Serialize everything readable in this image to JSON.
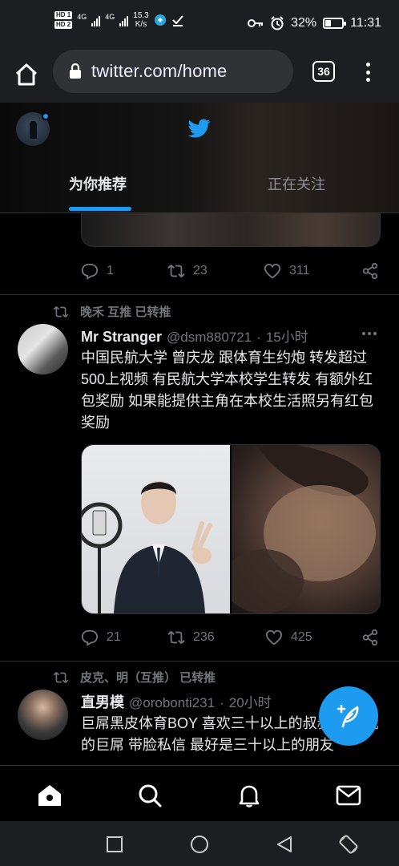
{
  "status_bar": {
    "hd1": "HD 1",
    "hd2": "HD 2",
    "net1": "4G",
    "net2": "4G",
    "speed_value": "15.3",
    "speed_unit": "K/s",
    "battery_text": "32%",
    "battery_level": 0.32,
    "time": "11:31"
  },
  "browser": {
    "url": "twitter.com/home",
    "tab_count": "36"
  },
  "header": {
    "tabs": [
      {
        "label": "为你推荐",
        "active": true
      },
      {
        "label": "正在关注",
        "active": false
      }
    ]
  },
  "tweets": [
    {
      "replies": "1",
      "retweets": "23",
      "likes": "311"
    },
    {
      "retweeted_by": "晚禾 互推 已转推",
      "name": "Mr Stranger",
      "handle": "@dsm880721",
      "time": "15小时",
      "text": "中国民航大学 曾庆龙 跟体育生约炮 转发超过500上视频 有民航大学本校学生转发 有额外红包奖励 如果能提供主角在本校生活照另有红包奖励",
      "replies": "21",
      "retweets": "236",
      "likes": "425"
    },
    {
      "retweeted_by": "皮克、明（互推） 已转推",
      "name": "直男模",
      "handle": "@orobonti231",
      "time": "20小时",
      "text": "巨屌黑皮体育BOY 喜欢三十以上的叔叔 来吃我的巨屌 带脸私信 最好是三十以上的朋友"
    }
  ],
  "colors": {
    "accent": "#1d9bf0",
    "background": "#000000",
    "muted": "#71767b"
  },
  "icons": {
    "nav": [
      "home-icon",
      "search-icon",
      "bell-icon",
      "mail-icon"
    ],
    "system": [
      "recents-square-icon",
      "home-circle-icon",
      "back-triangle-icon",
      "rotate-icon"
    ]
  }
}
